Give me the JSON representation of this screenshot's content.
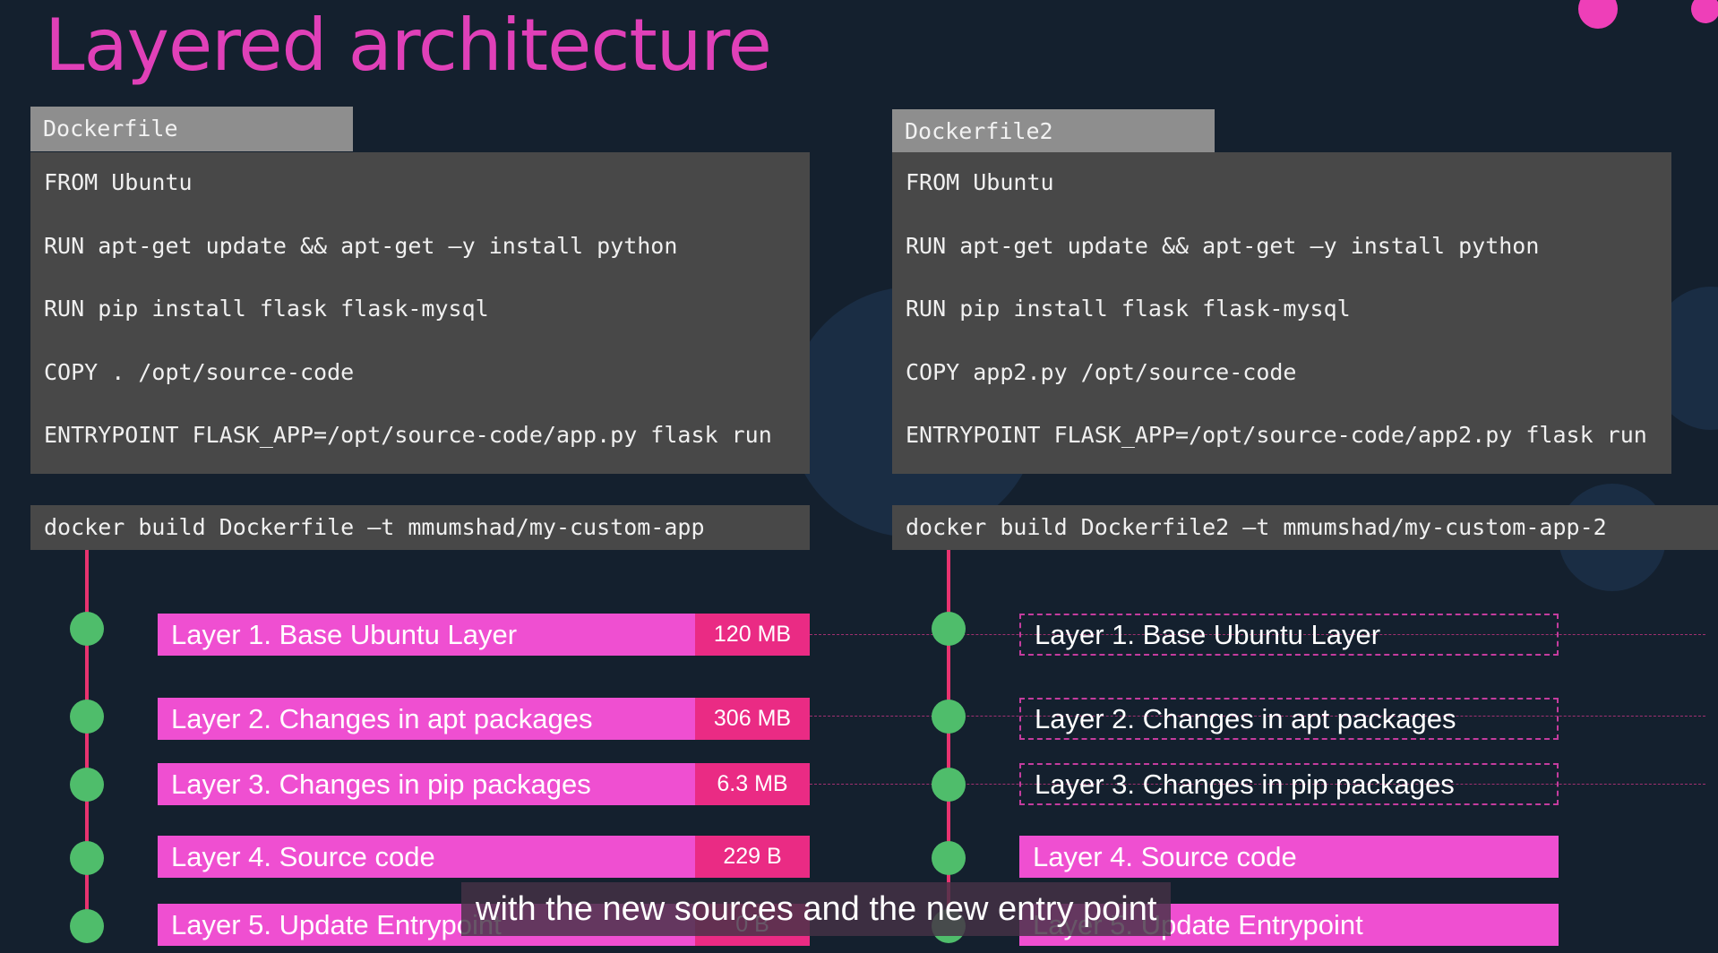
{
  "slide": {
    "title": "Layered architecture"
  },
  "left": {
    "filename": "Dockerfile",
    "code": [
      "FROM Ubuntu",
      "RUN apt-get update && apt-get –y install python",
      "RUN pip install flask flask-mysql",
      "COPY . /opt/source-code",
      "ENTRYPOINT FLASK_APP=/opt/source-code/app.py flask run"
    ],
    "build_command": "docker build Dockerfile –t mmumshad/my-custom-app",
    "layers": [
      {
        "label": "Layer 1. Base Ubuntu Layer",
        "size": "120 MB"
      },
      {
        "label": "Layer 2. Changes in apt packages",
        "size": "306 MB"
      },
      {
        "label": "Layer 3. Changes in pip packages",
        "size": "6.3 MB"
      },
      {
        "label": "Layer 4. Source code",
        "size": "229 B"
      },
      {
        "label": "Layer 5. Update Entrypoint",
        "size": "0 B"
      }
    ]
  },
  "right": {
    "filename": "Dockerfile2",
    "code": [
      "FROM Ubuntu",
      "RUN apt-get update && apt-get –y install python",
      "RUN pip install flask flask-mysql",
      "COPY app2.py /opt/source-code",
      "ENTRYPOINT FLASK_APP=/opt/source-code/app2.py flask run"
    ],
    "build_command": "docker build Dockerfile2 –t mmumshad/my-custom-app-2",
    "layers": [
      {
        "label": "Layer 1. Base Ubuntu Layer",
        "cached": true
      },
      {
        "label": "Layer 2. Changes in apt packages",
        "cached": true
      },
      {
        "label": "Layer 3. Changes in pip packages",
        "cached": true
      },
      {
        "label": "Layer 4. Source code",
        "cached": false
      },
      {
        "label": "Layer 5. Update Entrypoint",
        "cached": false
      }
    ]
  },
  "caption": "with the new sources and the new entry point",
  "colors": {
    "background": "#14202e",
    "title": "#e040b8",
    "layer": "#ef4fd1",
    "size_tag": "#ea2b84",
    "timeline": "#e8336f",
    "node": "#4fbd6b",
    "code_bg": "#484848",
    "tab_bg": "#8e8e8e"
  }
}
